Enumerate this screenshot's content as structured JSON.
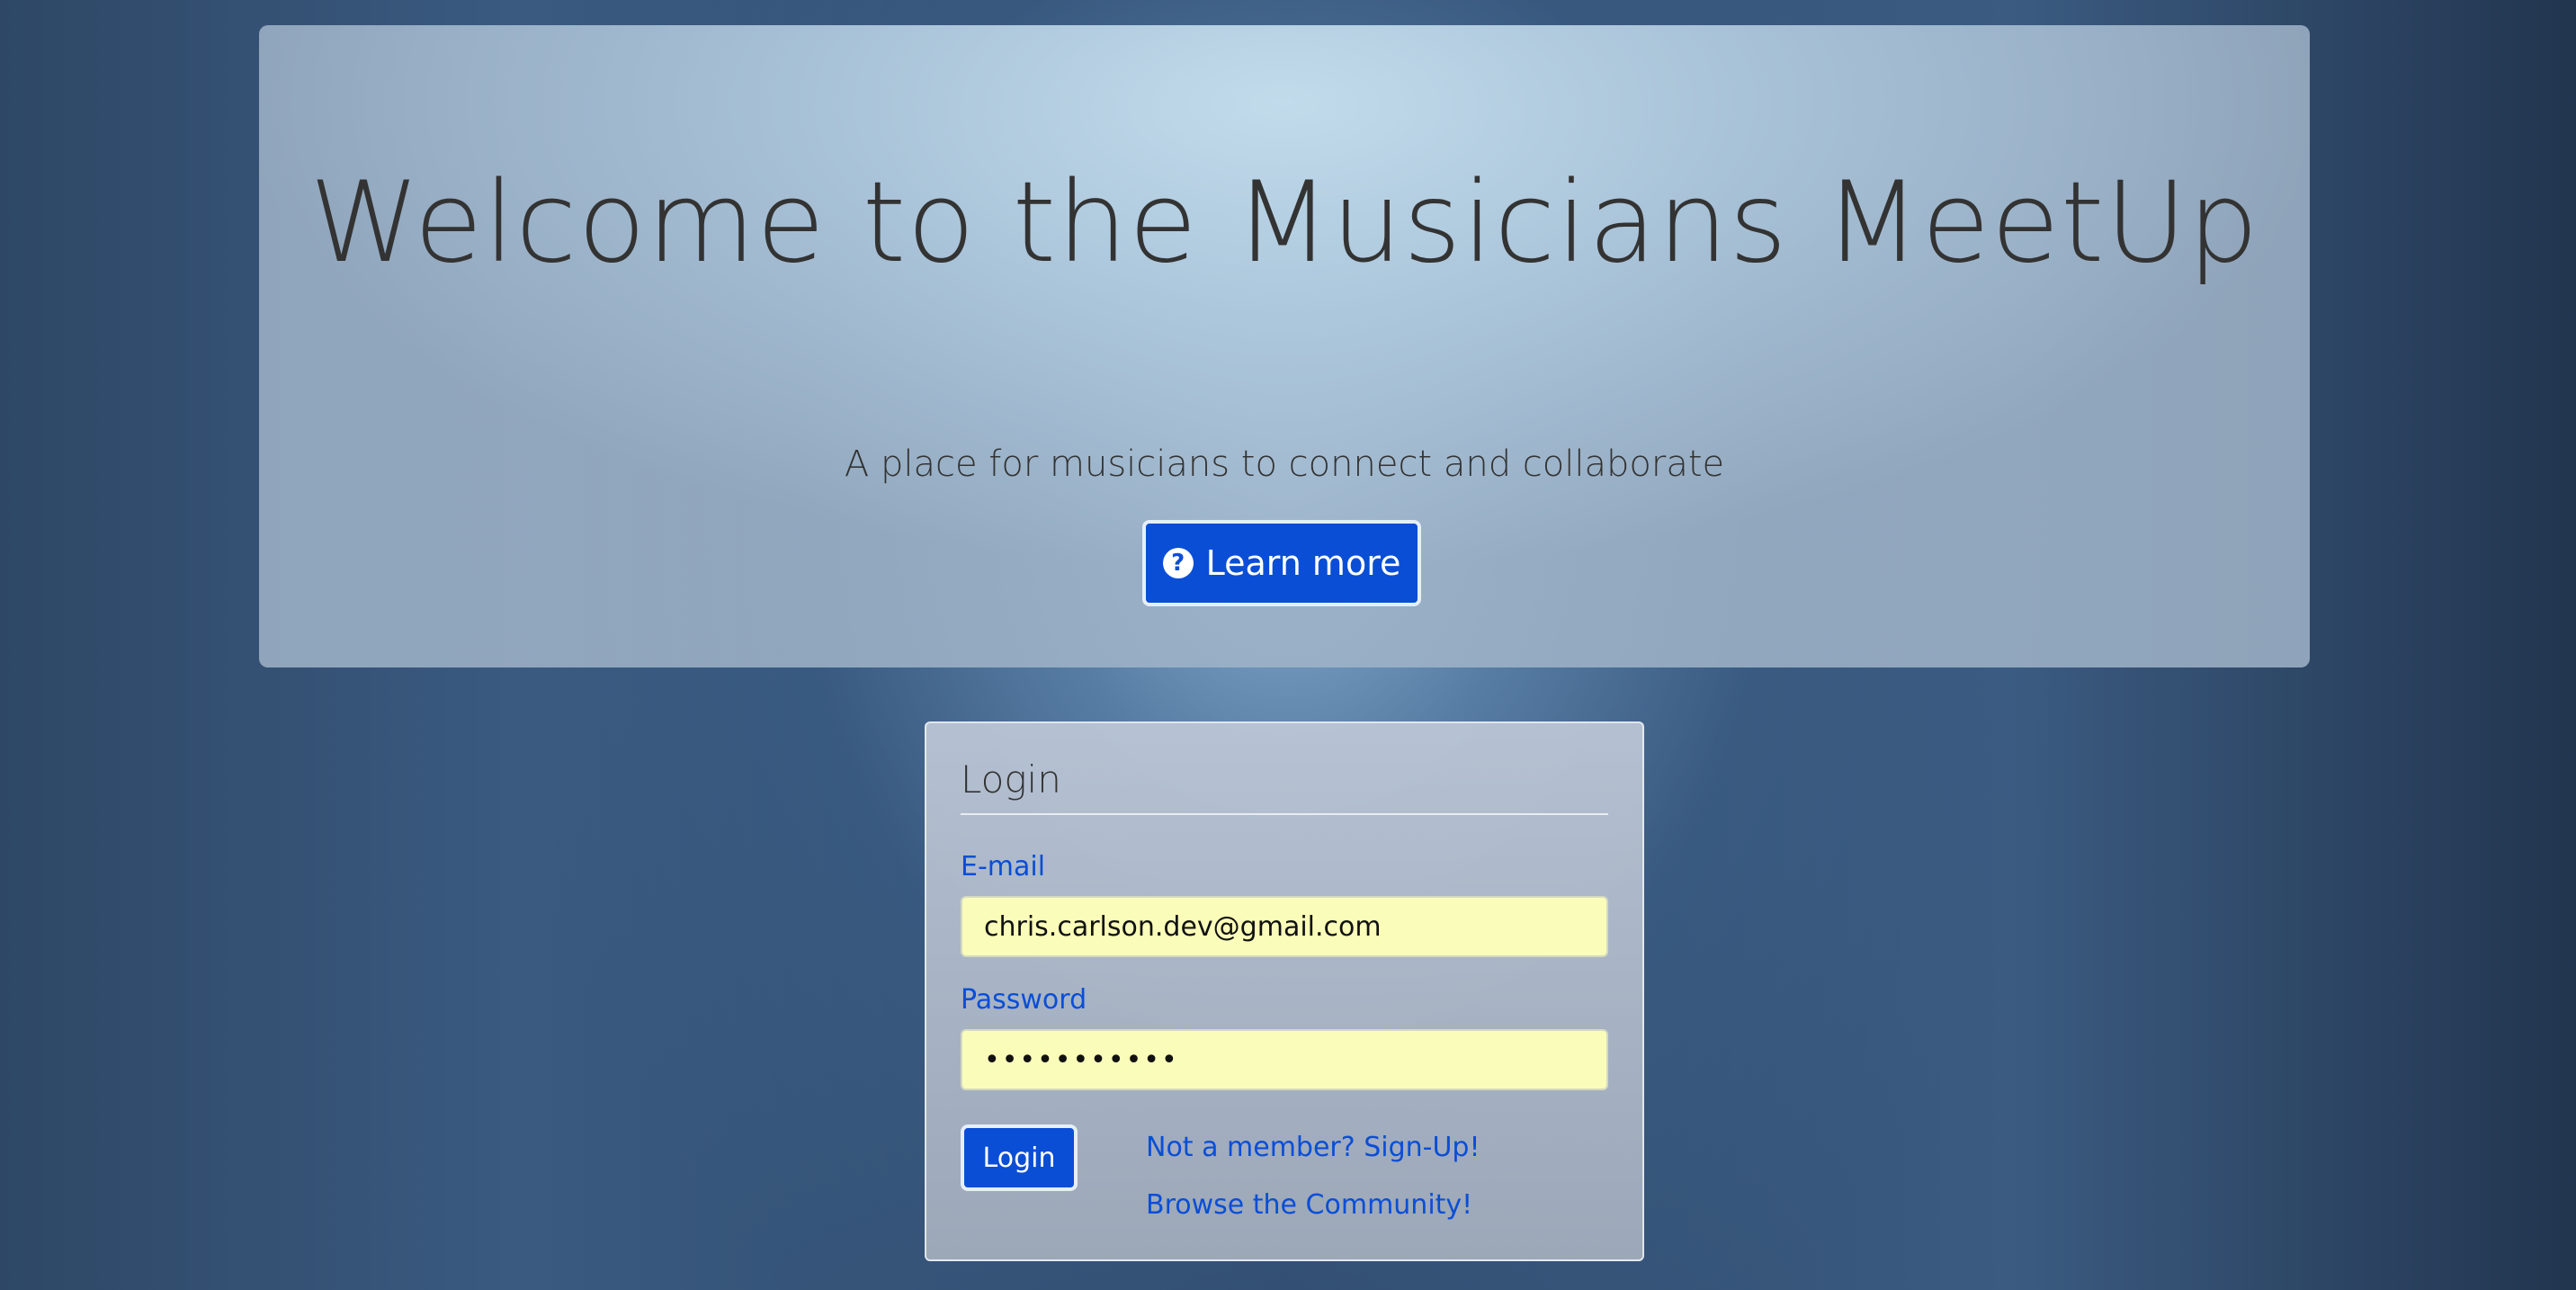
{
  "hero": {
    "title": "Welcome to the Musicians MeetUp",
    "subtitle": "A place for musicians to connect and collaborate",
    "learn_more_label": "Learn more",
    "learn_more_icon": "question-circle-icon"
  },
  "login": {
    "title": "Login",
    "email_label": "E-mail",
    "email_value": "chris.carlson.dev@gmail.com",
    "password_label": "Password",
    "password_value": "•••••••••••",
    "login_button_label": "Login",
    "signup_link": "Not a member? Sign-Up!",
    "browse_link": "Browse the Community!"
  },
  "colors": {
    "accent": "#0a4ed6",
    "autofill_bg": "#fafdb9"
  }
}
